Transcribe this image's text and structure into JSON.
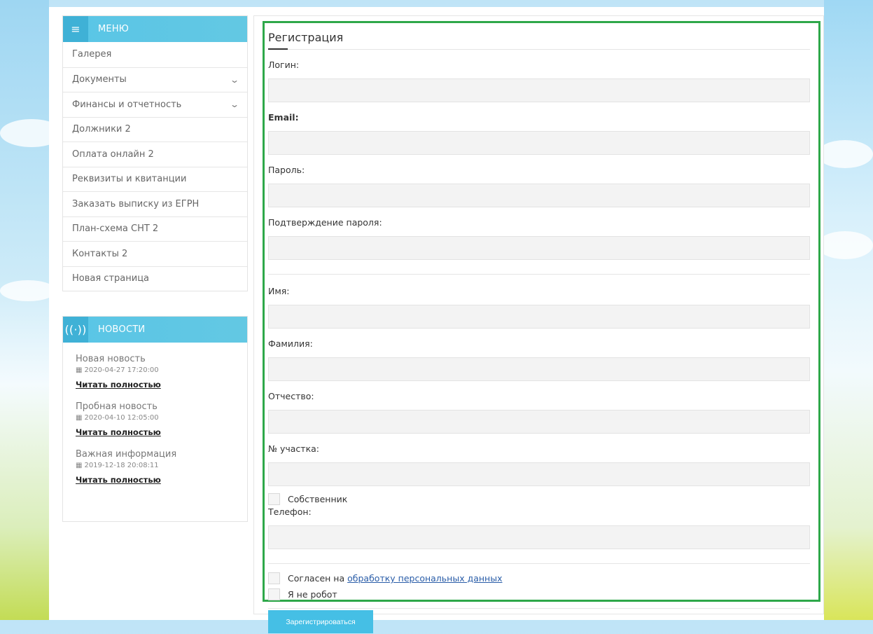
{
  "menu": {
    "title": "МЕНЮ",
    "items": [
      {
        "label": "Галерея",
        "has_submenu": false
      },
      {
        "label": "Документы",
        "has_submenu": true
      },
      {
        "label": "Финансы и отчетность",
        "has_submenu": true
      },
      {
        "label": "Должники 2",
        "has_submenu": false
      },
      {
        "label": "Оплата онлайн 2",
        "has_submenu": false
      },
      {
        "label": "Реквизиты и квитанции",
        "has_submenu": false
      },
      {
        "label": "Заказать выписку из ЕГРН",
        "has_submenu": false
      },
      {
        "label": "План-схема СНТ 2",
        "has_submenu": false
      },
      {
        "label": "Контакты 2",
        "has_submenu": false
      },
      {
        "label": "Новая страница",
        "has_submenu": false
      }
    ]
  },
  "news": {
    "title": "НОВОСТИ",
    "items": [
      {
        "title": "Новая новость",
        "date": "2020-04-27 17:20:00",
        "link": "Читать полностью"
      },
      {
        "title": "Пробная новость",
        "date": "2020-04-10 12:05:00",
        "link": "Читать полностью"
      },
      {
        "title": "Важная информация",
        "date": "2019-12-18 20:08:11",
        "link": "Читать полностью"
      }
    ]
  },
  "form": {
    "title": "Регистрация",
    "fields": {
      "login": {
        "label": "Логин:",
        "value": ""
      },
      "email": {
        "label": "Email:",
        "value": ""
      },
      "password": {
        "label": "Пароль:",
        "value": ""
      },
      "password_confirm": {
        "label": "Подтверждение пароля:",
        "value": ""
      },
      "first_name": {
        "label": "Имя:",
        "value": ""
      },
      "last_name": {
        "label": "Фамилия:",
        "value": ""
      },
      "patronymic": {
        "label": "Отчество:",
        "value": ""
      },
      "plot_number": {
        "label": "№ участка:",
        "value": ""
      },
      "phone": {
        "label": "Телефон:",
        "value": ""
      }
    },
    "owner_checkbox": {
      "label": "Собственник",
      "checked": false
    },
    "consent_checkbox": {
      "label": "Согласен на",
      "link_text": "обработку персональных данных",
      "checked": false
    },
    "robot_checkbox": {
      "label": "Я не робот",
      "checked": false
    },
    "submit_label": "Зарегистрироваться"
  },
  "colors": {
    "accent": "#5bc0de",
    "button": "#45bfe5",
    "highlight_border": "#2ea84a",
    "link": "#2a5da8"
  }
}
